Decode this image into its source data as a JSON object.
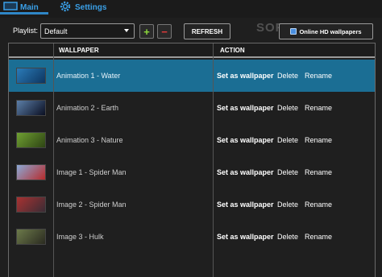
{
  "tabs": [
    {
      "label": "Main",
      "icon": "monitor-icon"
    },
    {
      "label": "Settings",
      "icon": "gear-icon"
    }
  ],
  "toolbar": {
    "playlist_label": "Playlist:",
    "playlist_value": "Default",
    "add_label": "+",
    "remove_label": "−",
    "refresh_label": "REFRESH",
    "online_label": "Online HD wallpapers"
  },
  "watermark": "SOFTPEDIA",
  "table": {
    "columns": [
      "WALLPAPER",
      "ACTION"
    ],
    "actions": {
      "set": "Set as wallpaper",
      "delete": "Delete",
      "rename": "Rename"
    },
    "rows": [
      {
        "name": "Animation 1 - Water",
        "selected": true,
        "thumb_colors": [
          "#2a7bb8",
          "#0d3560"
        ]
      },
      {
        "name": "Animation 2 - Earth",
        "selected": false,
        "thumb_colors": [
          "#5c7fa8",
          "#0a0f22"
        ]
      },
      {
        "name": "Animation 3 - Nature",
        "selected": false,
        "thumb_colors": [
          "#6fa032",
          "#2e4414"
        ]
      },
      {
        "name": "Image 1 - Spider Man",
        "selected": false,
        "thumb_colors": [
          "#8ba9d6",
          "#b62b2b"
        ]
      },
      {
        "name": "Image 2 - Spider Man",
        "selected": false,
        "thumb_colors": [
          "#a83232",
          "#3a2c34"
        ]
      },
      {
        "name": "Image 3 - Hulk",
        "selected": false,
        "thumb_colors": [
          "#6c7a4a",
          "#2a2a20"
        ]
      }
    ]
  },
  "colors": {
    "accent": "#3aa0e8",
    "selected_row": "#1b6e94",
    "background": "#1f1f1f"
  }
}
